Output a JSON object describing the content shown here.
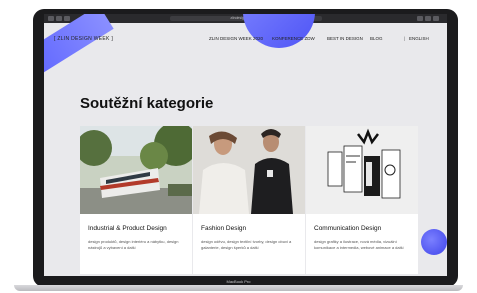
{
  "browser": {
    "url": "zlindesignweek.com"
  },
  "site": {
    "logo": "[ ZLIN DESIGN WEEK ]",
    "nav": [
      "ZLIN DESIGN WEEK 2020",
      "KONFERENCE ZDW",
      "BEST IN DESIGN",
      "BLOG",
      "ENGLISH"
    ],
    "nav_separator": "|"
  },
  "page": {
    "title": "Soutěžní kategorie",
    "cards": [
      {
        "title": "Industrial & Product Design",
        "desc": "design produktů, design interiéru a nábytku, design nástrojů a vybavení a další"
      },
      {
        "title": "Fashion Design",
        "desc": "design oděvu, design textilní tvorby, design obuvi a galanterie, design šperků a další"
      },
      {
        "title": "Communication Design",
        "desc": "design grafiky a ilustrace, nová média, vizuální komunikace a intermedia, webové animace a další"
      }
    ]
  },
  "device": {
    "label": "MacBook Pro"
  },
  "colors": {
    "accent": "#5b61ff",
    "background": "#e9e9ec"
  }
}
